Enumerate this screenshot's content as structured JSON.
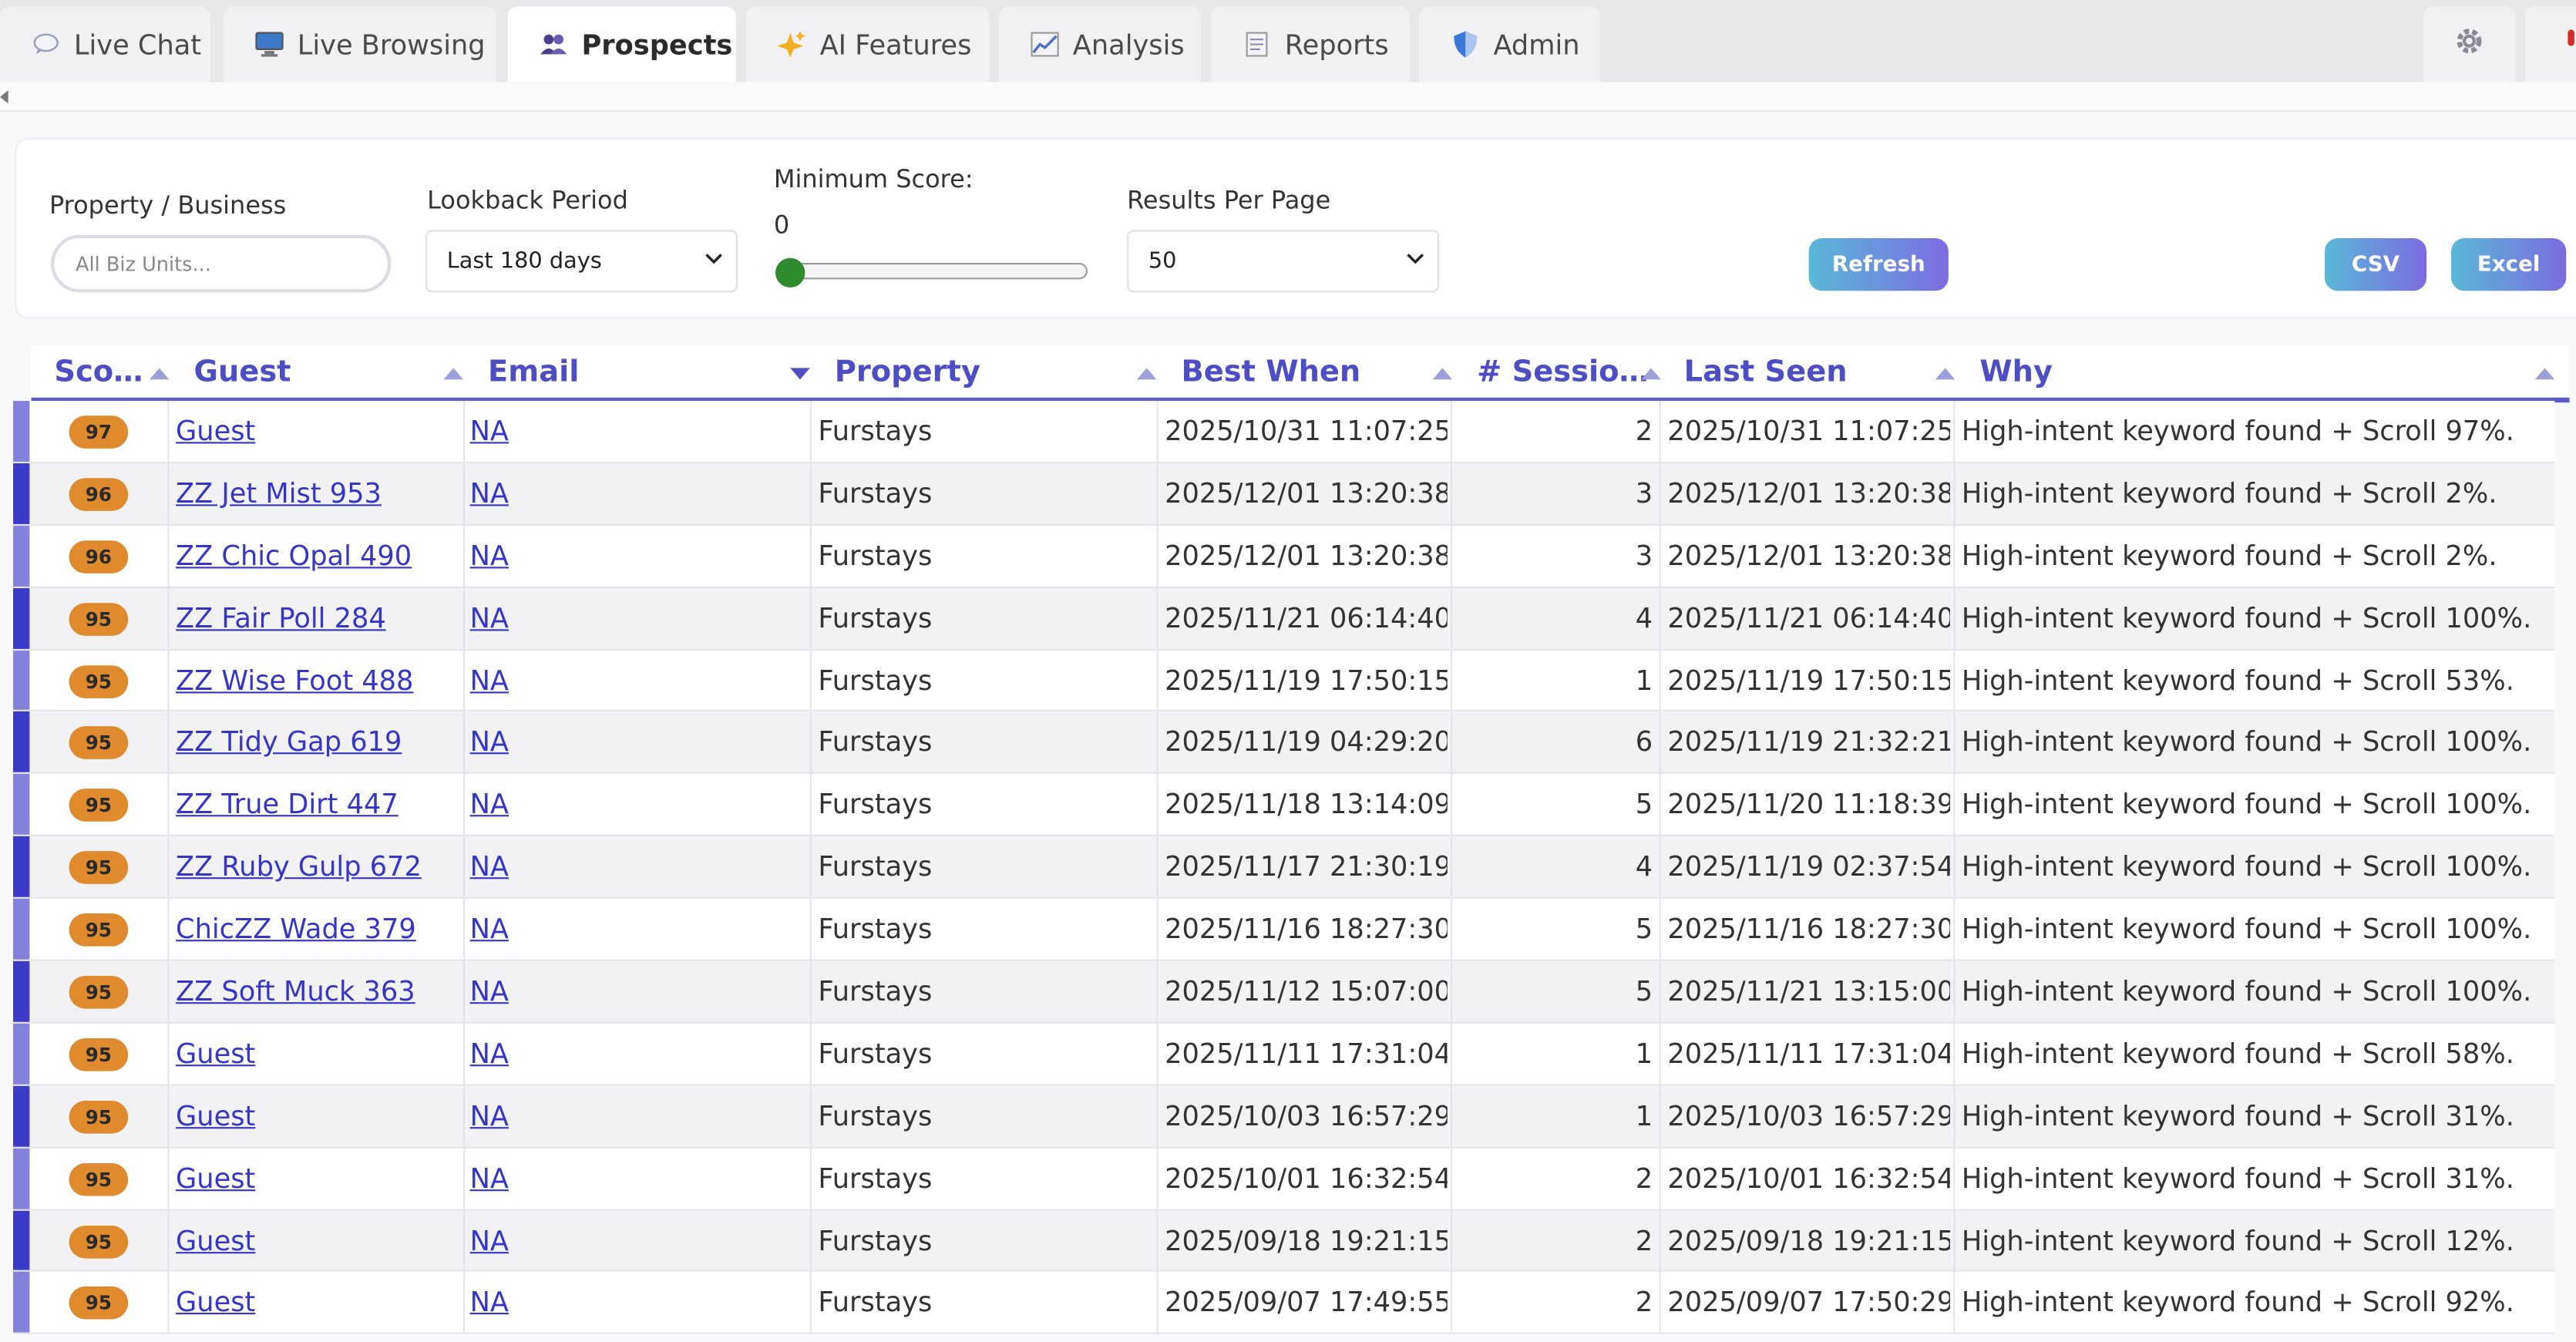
{
  "tabs": [
    {
      "label": "Live Chat",
      "icon": "speech-bubble-icon"
    },
    {
      "label": "Live Browsing",
      "icon": "monitor-icon"
    },
    {
      "label": "Prospects",
      "icon": "people-icon",
      "active": true
    },
    {
      "label": "AI Features",
      "icon": "sparkles-icon"
    },
    {
      "label": "Analysis",
      "icon": "chart-icon"
    },
    {
      "label": "Reports",
      "icon": "document-icon"
    },
    {
      "label": "Admin",
      "icon": "shield-icon"
    }
  ],
  "filters": {
    "property_label": "Property / Business",
    "property_placeholder": "All Biz Units...",
    "lookback_label": "Lookback Period",
    "lookback_value": "Last 180 days",
    "min_score_label": "Minimum Score:",
    "min_score_value": "0",
    "per_page_label": "Results Per Page",
    "per_page_value": "50",
    "refresh_label": "Refresh",
    "csv_label": "CSV",
    "excel_label": "Excel"
  },
  "columns": [
    "Sco…",
    "Guest",
    "Email",
    "Property",
    "Best When",
    "# Sessio…",
    "Last Seen",
    "Why"
  ],
  "colors": {
    "accent": "#4e4ec4",
    "badge": "#e08a2e",
    "bar_dark": "#3b3bc8",
    "bar_light": "#8282dc"
  },
  "rows": [
    {
      "score": "97",
      "guest": "Guest",
      "email": "NA",
      "property": "Furstays",
      "best_when": "2025/10/31 11:07:25",
      "sessions": "2",
      "last_seen": "2025/10/31 11:07:25",
      "why": "High-intent keyword found + Scroll 97%."
    },
    {
      "score": "96",
      "guest": "ZZ Jet Mist 953",
      "email": "NA",
      "property": "Furstays",
      "best_when": "2025/12/01 13:20:38",
      "sessions": "3",
      "last_seen": "2025/12/01 13:20:38",
      "why": "High-intent keyword found + Scroll 2%."
    },
    {
      "score": "96",
      "guest": "ZZ Chic Opal 490",
      "email": "NA",
      "property": "Furstays",
      "best_when": "2025/12/01 13:20:38",
      "sessions": "3",
      "last_seen": "2025/12/01 13:20:38",
      "why": "High-intent keyword found + Scroll 2%."
    },
    {
      "score": "95",
      "guest": "ZZ Fair Poll 284",
      "email": "NA",
      "property": "Furstays",
      "best_when": "2025/11/21 06:14:40",
      "sessions": "4",
      "last_seen": "2025/11/21 06:14:40",
      "why": "High-intent keyword found + Scroll 100%."
    },
    {
      "score": "95",
      "guest": "ZZ Wise Foot 488",
      "email": "NA",
      "property": "Furstays",
      "best_when": "2025/11/19 17:50:15",
      "sessions": "1",
      "last_seen": "2025/11/19 17:50:15",
      "why": "High-intent keyword found + Scroll 53%."
    },
    {
      "score": "95",
      "guest": "ZZ Tidy Gap 619",
      "email": "NA",
      "property": "Furstays",
      "best_when": "2025/11/19 04:29:20",
      "sessions": "6",
      "last_seen": "2025/11/19 21:32:21",
      "why": "High-intent keyword found + Scroll 100%."
    },
    {
      "score": "95",
      "guest": "ZZ True Dirt 447",
      "email": "NA",
      "property": "Furstays",
      "best_when": "2025/11/18 13:14:09",
      "sessions": "5",
      "last_seen": "2025/11/20 11:18:39",
      "why": "High-intent keyword found + Scroll 100%."
    },
    {
      "score": "95",
      "guest": "ZZ Ruby Gulp 672",
      "email": "NA",
      "property": "Furstays",
      "best_when": "2025/11/17 21:30:19",
      "sessions": "4",
      "last_seen": "2025/11/19 02:37:54",
      "why": "High-intent keyword found + Scroll 100%."
    },
    {
      "score": "95",
      "guest": "ChicZZ Wade 379",
      "email": "NA",
      "property": "Furstays",
      "best_when": "2025/11/16 18:27:30",
      "sessions": "5",
      "last_seen": "2025/11/16 18:27:30",
      "why": "High-intent keyword found + Scroll 100%."
    },
    {
      "score": "95",
      "guest": "ZZ Soft Muck 363",
      "email": "NA",
      "property": "Furstays",
      "best_when": "2025/11/12 15:07:00",
      "sessions": "5",
      "last_seen": "2025/11/21 13:15:00",
      "why": "High-intent keyword found + Scroll 100%."
    },
    {
      "score": "95",
      "guest": "Guest",
      "email": "NA",
      "property": "Furstays",
      "best_when": "2025/11/11 17:31:04",
      "sessions": "1",
      "last_seen": "2025/11/11 17:31:04",
      "why": "High-intent keyword found + Scroll 58%."
    },
    {
      "score": "95",
      "guest": "Guest",
      "email": "NA",
      "property": "Furstays",
      "best_when": "2025/10/03 16:57:29",
      "sessions": "1",
      "last_seen": "2025/10/03 16:57:29",
      "why": "High-intent keyword found + Scroll 31%."
    },
    {
      "score": "95",
      "guest": "Guest",
      "email": "NA",
      "property": "Furstays",
      "best_when": "2025/10/01 16:32:54",
      "sessions": "2",
      "last_seen": "2025/10/01 16:32:54",
      "why": "High-intent keyword found + Scroll 31%."
    },
    {
      "score": "95",
      "guest": "Guest",
      "email": "NA",
      "property": "Furstays",
      "best_when": "2025/09/18 19:21:15",
      "sessions": "2",
      "last_seen": "2025/09/18 19:21:15",
      "why": "High-intent keyword found + Scroll 12%."
    },
    {
      "score": "95",
      "guest": "Guest",
      "email": "NA",
      "property": "Furstays",
      "best_when": "2025/09/07 17:49:55",
      "sessions": "2",
      "last_seen": "2025/09/07 17:50:29",
      "why": "High-intent keyword found + Scroll 92%."
    }
  ]
}
